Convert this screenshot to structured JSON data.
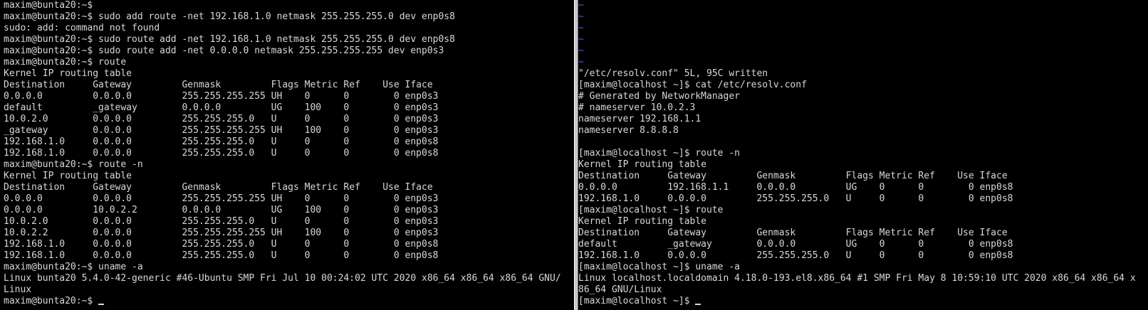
{
  "left_terminal": {
    "prompt": "maxim@bunta20:~$",
    "lines": [
      "maxim@bunta20:~$",
      "maxim@bunta20:~$ sudo add route -net 192.168.1.0 netmask 255.255.255.0 dev enp0s8",
      "sudo: add: command not found",
      "maxim@bunta20:~$ sudo route add -net 192.168.1.0 netmask 255.255.255.0 dev enp0s8",
      "maxim@bunta20:~$ sudo route add -net 0.0.0.0 netmask 255.255.255.255 dev enp0s3",
      "maxim@bunta20:~$ route",
      "Kernel IP routing table",
      "Destination     Gateway         Genmask         Flags Metric Ref    Use Iface",
      "0.0.0.0         0.0.0.0         255.255.255.255 UH    0      0        0 enp0s3",
      "default         _gateway        0.0.0.0         UG    100    0        0 enp0s3",
      "10.0.2.0        0.0.0.0         255.255.255.0   U     0      0        0 enp0s3",
      "_gateway        0.0.0.0         255.255.255.255 UH    100    0        0 enp0s3",
      "192.168.1.0     0.0.0.0         255.255.255.0   U     0      0        0 enp0s8",
      "192.168.1.0     0.0.0.0         255.255.255.0   U     0      0        0 enp0s8",
      "maxim@bunta20:~$ route -n",
      "Kernel IP routing table",
      "Destination     Gateway         Genmask         Flags Metric Ref    Use Iface",
      "0.0.0.0         0.0.0.0         255.255.255.255 UH    0      0        0 enp0s3",
      "0.0.0.0         10.0.2.2        0.0.0.0         UG    100    0        0 enp0s3",
      "10.0.2.0        0.0.0.0         255.255.255.0   U     0      0        0 enp0s3",
      "10.0.2.2        0.0.0.0         255.255.255.255 UH    100    0        0 enp0s3",
      "192.168.1.0     0.0.0.0         255.255.255.0   U     0      0        0 enp0s8",
      "192.168.1.0     0.0.0.0         255.255.255.0   U     0      0        0 enp0s8",
      "maxim@bunta20:~$ uname -a",
      "Linux bunta20 5.4.0-42-generic #46-Ubuntu SMP Fri Jul 10 00:24:02 UTC 2020 x86_64 x86_64 x86_64 GNU/",
      "Linux",
      "maxim@bunta20:~$ "
    ]
  },
  "right_terminal": {
    "prompt": "[maxim@localhost ~]$",
    "tilde_lines": [
      "~",
      "~",
      "~",
      "~",
      "~",
      "~"
    ],
    "lines": [
      "\"/etc/resolv.conf\" 5L, 95C written",
      "[maxim@localhost ~]$ cat /etc/resolv.conf",
      "# Generated by NetworkManager",
      "# nameserver 10.0.2.3",
      "nameserver 192.168.1.1",
      "nameserver 8.8.8.8",
      "",
      "[maxim@localhost ~]$ route -n",
      "Kernel IP routing table",
      "Destination     Gateway         Genmask         Flags Metric Ref    Use Iface",
      "0.0.0.0         192.168.1.1     0.0.0.0         UG    0      0        0 enp0s8",
      "192.168.1.0     0.0.0.0         255.255.255.0   U     0      0        0 enp0s8",
      "[maxim@localhost ~]$ route",
      "Kernel IP routing table",
      "Destination     Gateway         Genmask         Flags Metric Ref    Use Iface",
      "default         _gateway        0.0.0.0         UG    0      0        0 enp0s8",
      "192.168.1.0     0.0.0.0         255.255.255.0   U     0      0        0 enp0s8",
      "[maxim@localhost ~]$ uname -a",
      "Linux localhost.localdomain 4.18.0-193.el8.x86_64 #1 SMP Fri May 8 10:59:10 UTC 2020 x86_64 x86_64 x",
      "86_64 GNU/Linux",
      "[maxim@localhost ~]$ "
    ]
  },
  "colors": {
    "background": "#000000",
    "text": "#d8d8d8",
    "tilde": "#4a5cff",
    "divider": "#c8c8c8"
  }
}
